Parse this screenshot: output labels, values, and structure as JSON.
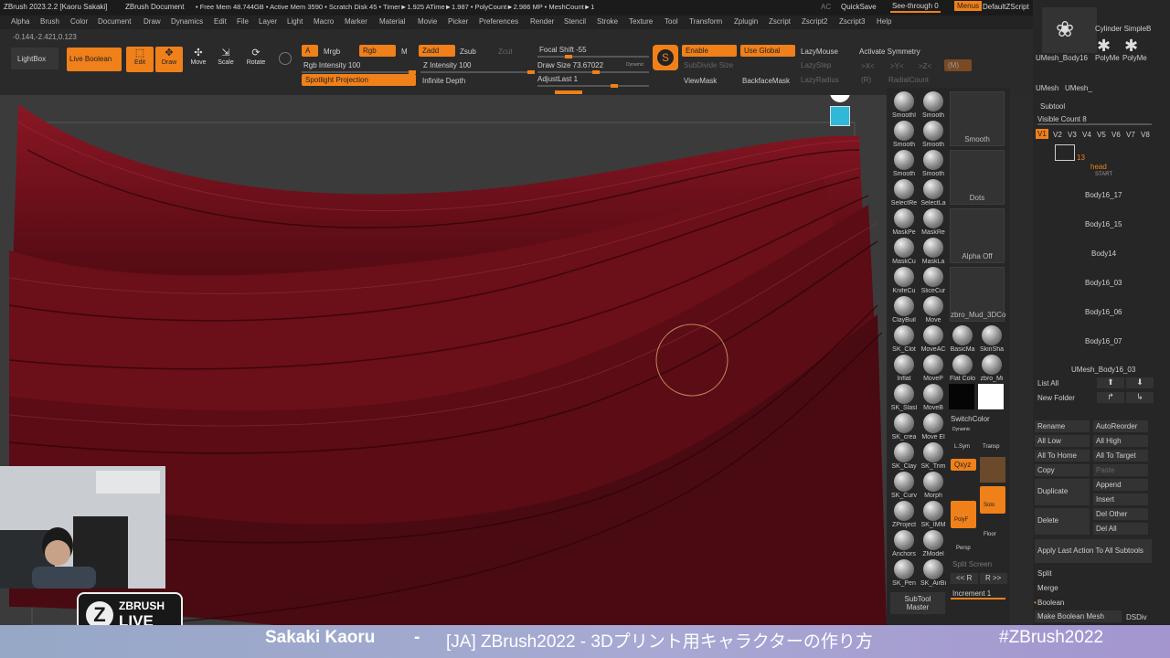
{
  "titlebar": {
    "app": "ZBrush 2023.2.2 [Kaoru Sakaki]",
    "doc": "ZBrush Document",
    "stats": "• Free Mem 48.744GB • Active Mem 3590 • Scratch Disk 45 • Timer►1.925 ATime►1.987 • PolyCount►2.986 MP • MeshCount►1",
    "ac": "AC",
    "quicksave": "QuickSave",
    "seethrough": "See-through  0",
    "menus": "Menus",
    "script": "DefaultZScript"
  },
  "menubar": [
    "Alpha",
    "Brush",
    "Color",
    "Document",
    "Draw",
    "Dynamics",
    "Edit",
    "File",
    "Layer",
    "Light",
    "Macro",
    "Marker",
    "Material",
    "Movie",
    "Picker",
    "Preferences",
    "Render",
    "Stencil",
    "Stroke",
    "Texture",
    "Tool",
    "Transform",
    "Zplugin",
    "Zscript",
    "Zscript2",
    "Zscript3",
    "Help"
  ],
  "coords": "-0.144,-2.421,0.123",
  "shelf": {
    "lightbox": "LightBox",
    "liveboolean": "Live Boolean",
    "edit": "Edit",
    "draw": "Draw",
    "move": "Move",
    "scale": "Scale",
    "rotate": "Rotate",
    "a": "A",
    "mrgb": "Mrgb",
    "rgb": "Rgb",
    "m": "M",
    "zadd": "Zadd",
    "zsub": "Zsub",
    "zcut": "Zcut",
    "rgb_intensity": "Rgb Intensity 100",
    "z_intensity": "Z Intensity 100",
    "spotlight": "Spotlight Projection",
    "infinite_depth": "Infinite Depth",
    "focal_shift": "Focal Shift -55",
    "draw_size": "Draw Size 73.67022",
    "dynamic": "Dynamic",
    "adjustlast": "AdjustLast 1",
    "enable": "Enable",
    "use_global": "Use Global",
    "subdivide_size": "SubDivide Size",
    "viewmask": "ViewMask",
    "backfacemask": "BackfaceMask",
    "lazymouse": "LazyMouse",
    "lazystep": "LazyStep",
    "lazyradius": "LazyRadius",
    "activate_symmetry": "Activate Symmetry",
    "x": ">X<",
    "y": ">Y<",
    "z": ">Z<",
    "m_btn": "(M)",
    "r": "(R)",
    "radialcount": "RadialCount"
  },
  "brushes": [
    {
      "label": "SmoothI"
    },
    {
      "label": "Smooth"
    },
    {
      "label": "Smooth"
    },
    {
      "label": "Smooth"
    },
    {
      "label": "Smooth"
    },
    {
      "label": "Smooth"
    },
    {
      "label": "SelectRe"
    },
    {
      "label": "SelectLa"
    },
    {
      "label": "MaskPe"
    },
    {
      "label": "MaskRe"
    },
    {
      "label": "MaskCu"
    },
    {
      "label": "MaskLa"
    },
    {
      "label": "KnifeCu"
    },
    {
      "label": "SliceCur"
    },
    {
      "label": "ClayBuil"
    },
    {
      "label": "Move"
    },
    {
      "label": "SK_Clot"
    },
    {
      "label": "MoveAC"
    },
    {
      "label": "Inflat"
    },
    {
      "label": "MoveP"
    },
    {
      "label": "SK_Slasl"
    },
    {
      "label": "MoveB"
    },
    {
      "label": "SK_crea"
    },
    {
      "label": "Move El"
    },
    {
      "label": "SK_Clay"
    },
    {
      "label": "SK_Trim"
    },
    {
      "label": "SK_Curv"
    },
    {
      "label": "Morph"
    },
    {
      "label": "ZProject"
    },
    {
      "label": "SK_IMM"
    },
    {
      "label": "Anchors"
    },
    {
      "label": "ZModel"
    },
    {
      "label": "SK_Pen"
    },
    {
      "label": "SK_AirBi"
    }
  ],
  "brushcol3": [
    "BasicMa",
    "SkinSha",
    "Flat Colo",
    "zbro_Mi"
  ],
  "thumbs": {
    "smooth": "Smooth",
    "dots": "Dots",
    "alphaoff": "Alpha Off",
    "mud": "zbro_Mud_3DCo"
  },
  "switchcolor": "SwitchColor",
  "qxyz": "Qxyz",
  "solo": "Solo",
  "polyf": "PolyF",
  "floor": "Floor",
  "persp": "Persp",
  "transp": "Transp",
  "dynamic2": "Dynamic",
  "lsym": "L.Sym",
  "splitscreen": "Split Screen",
  "r_left": "<< R",
  "r_right": "R >>",
  "increment": "Increment 1",
  "subtool_master": "SubTool Master",
  "right": {
    "tools": [
      "UMesh_Body16",
      "PolyMe",
      "PolyMe",
      "UMesh",
      "UMesh_"
    ],
    "cylinder": "Cylinder SimpleB",
    "subtool_title": "Subtool",
    "visible_count": "Visible Count 8",
    "versions": [
      "V1",
      "V2",
      "V3",
      "V4",
      "V5",
      "V6",
      "V7",
      "V8"
    ],
    "count13": "13",
    "head": "head",
    "start": "START",
    "items": [
      "Body16_17",
      "Body16_15",
      "Body14",
      "Body16_03",
      "Body16_06",
      "Body16_07",
      "UMesh_Body16_03"
    ],
    "listall": "List All",
    "newfolder": "New Folder",
    "rename": "Rename",
    "autoreorder": "AutoReorder",
    "alllow": "All Low",
    "allhigh": "All High",
    "alltohome": "All To Home",
    "alltotarget": "All To Target",
    "copy": "Copy",
    "paste": "Paste",
    "duplicate": "Duplicate",
    "append": "Append",
    "insert": "Insert",
    "delete": "Delete",
    "delother": "Del Other",
    "delall": "Del All",
    "applylast": "Apply Last Action To All Subtools",
    "split": "Split",
    "merge": "Merge",
    "boolean": "Boolean",
    "makeboolean": "Make Boolean Mesh",
    "dsdiv": "DSDiv"
  },
  "logo": {
    "brand": "ZBRUSH",
    "live": "LIVE"
  },
  "banner": {
    "name": "Sakaki Kaoru",
    "dash": "-",
    "title": "[JA] ZBrush2022 - 3Dプリント用キャラクターの作り方",
    "tag": "#ZBrush2022"
  },
  "colors": {
    "accent": "#f0801a",
    "hair": "#6b0f18",
    "banner": "#a0a8d0"
  }
}
